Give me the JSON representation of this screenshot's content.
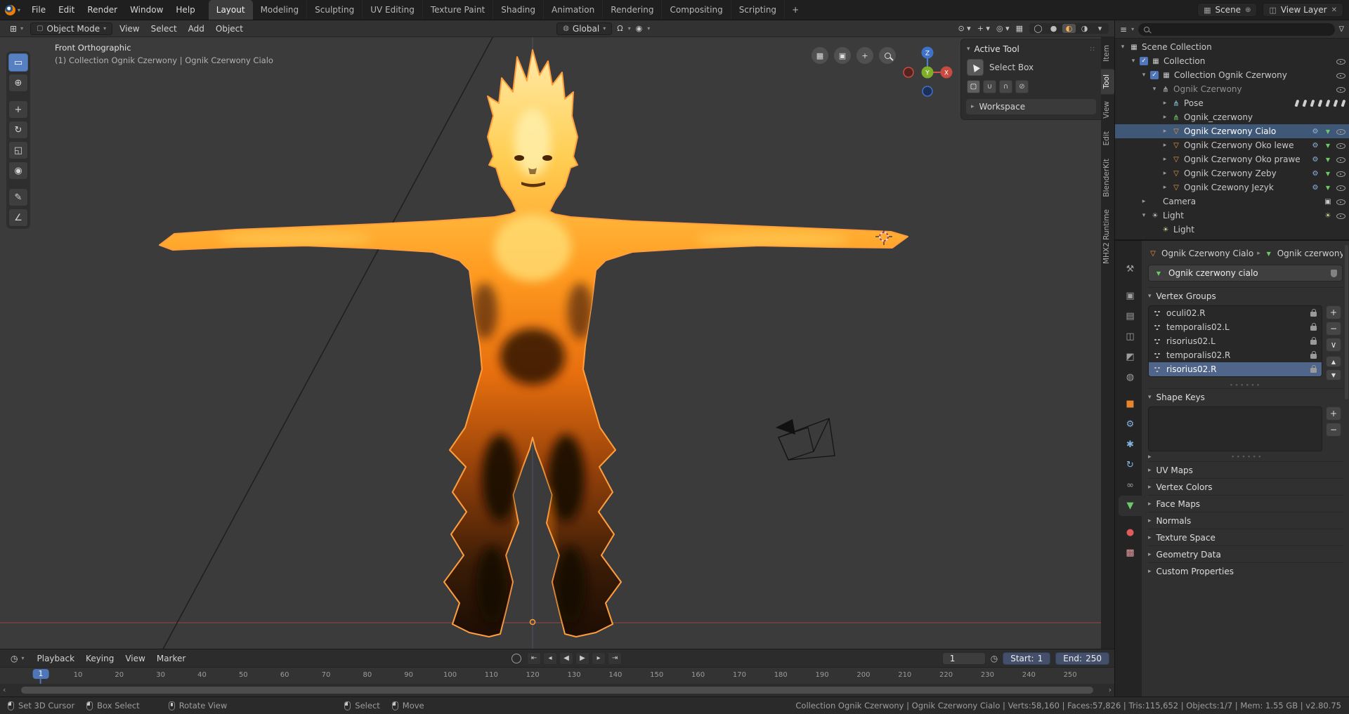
{
  "icons": {
    "editor_viewport": "⊞",
    "editor_outliner": "≡",
    "editor_timeline": "◷",
    "mode_cube": "▢",
    "orientation": "◍",
    "magnet": "Ω",
    "proportional": "◉",
    "scene": "▦",
    "view_layer": "◫",
    "new": "⊕",
    "unlink": "✕",
    "funnel": "∇",
    "breadcrumb_sep": "▸",
    "panel_dots": "∷",
    "clock": "◷",
    "scroll_left": "‹",
    "scroll_right": "›",
    "plus": "+",
    "minus": "−",
    "menu_down": "∨",
    "up": "▲",
    "down": "▼",
    "arrow_open": "▾",
    "arrow_closed": "▸"
  },
  "topbar": {
    "menus": [
      {
        "label": "File"
      },
      {
        "label": "Edit"
      },
      {
        "label": "Render"
      },
      {
        "label": "Window"
      },
      {
        "label": "Help"
      }
    ],
    "workspaces": [
      {
        "label": "Layout",
        "cls": "active"
      },
      {
        "label": "Modeling"
      },
      {
        "label": "Sculpting"
      },
      {
        "label": "UV Editing"
      },
      {
        "label": "Texture Paint"
      },
      {
        "label": "Shading"
      },
      {
        "label": "Animation"
      },
      {
        "label": "Rendering"
      },
      {
        "label": "Compositing"
      },
      {
        "label": "Scripting"
      }
    ],
    "add_workspace": "+",
    "scene_label": "Scene",
    "view_layer_label": "View Layer"
  },
  "viewport_header": {
    "mode_label": "Object Mode",
    "menus": [
      {
        "label": "View"
      },
      {
        "label": "Select"
      },
      {
        "label": "Add"
      },
      {
        "label": "Object"
      }
    ],
    "orientation_label": "Global",
    "right_icons": [
      {
        "name": "selectability-dropdown",
        "glyph": "⊙ ▾"
      },
      {
        "name": "gizmos-dropdown",
        "glyph": "+ ▾"
      },
      {
        "name": "overlays-dropdown",
        "glyph": "◎ ▾"
      },
      {
        "name": "xray-toggle",
        "glyph": "▦"
      }
    ],
    "shading_modes": [
      {
        "name": "shading-wireframe",
        "glyph": "◯"
      },
      {
        "name": "shading-solid",
        "glyph": "●"
      },
      {
        "name": "shading-material",
        "glyph": "◐",
        "cls": "active"
      },
      {
        "name": "shading-rendered",
        "glyph": "◑"
      },
      {
        "name": "shading-dropdown",
        "glyph": "▾"
      }
    ]
  },
  "toolbar": [
    {
      "name": "select-box-tool",
      "glyph": "▭",
      "cls": "active"
    },
    {
      "name": "cursor-tool",
      "glyph": "⊕"
    },
    {
      "name": "move-tool",
      "glyph": "+",
      "cls": "gap"
    },
    {
      "name": "rotate-tool",
      "glyph": "↻"
    },
    {
      "name": "scale-tool",
      "glyph": "◱"
    },
    {
      "name": "transform-tool",
      "glyph": "◉"
    },
    {
      "name": "annotate-tool",
      "glyph": "✎",
      "cls": "gap"
    },
    {
      "name": "measure-tool",
      "glyph": "∠"
    }
  ],
  "viewport": {
    "view_label": "Front Orthographic",
    "context_label": "(1) Collection Ognik Czerwony | Ognik Czerwony Cialo",
    "nav_buttons": [
      {
        "name": "orbit-grid-icon",
        "glyph": "▦"
      },
      {
        "name": "camera-view-icon",
        "glyph": "▣"
      },
      {
        "name": "pan-view-icon",
        "glyph": "+"
      },
      {
        "name": "zoom-view-icon",
        "glyph": "",
        "cls": "mag"
      }
    ],
    "gizmo": {
      "x": "X",
      "y": "Y",
      "z": "Z"
    },
    "side_tabs": [
      {
        "label": "Item"
      },
      {
        "label": "Tool",
        "cls": "active"
      },
      {
        "label": "View"
      },
      {
        "label": "Edit"
      },
      {
        "label": "BlenderKit"
      },
      {
        "label": "MHX2 Runtime"
      }
    ],
    "tool_panel": {
      "title": "Active Tool",
      "tool_name": "Select Box",
      "workspace": "Workspace",
      "options": [
        {
          "name": "select-mode-new",
          "glyph": "▢",
          "cls": "active"
        },
        {
          "name": "select-mode-extend",
          "glyph": "∪"
        },
        {
          "name": "select-mode-subtract",
          "glyph": "∩"
        },
        {
          "name": "select-mode-invert",
          "glyph": "⊘"
        }
      ]
    }
  },
  "outliner": {
    "rows": [
      {
        "label": "Scene Collection",
        "cls": "l0",
        "arrow": "▾",
        "icon": "i-scenecol",
        "right": []
      },
      {
        "label": "Collection",
        "cls": "l1",
        "arrow": "▾",
        "icon": "i-collection",
        "check": true,
        "right": [
          "i-eye"
        ]
      },
      {
        "label": "Collection Ognik Czerwony",
        "cls": "l2",
        "arrow": "▾",
        "icon": "i-collection",
        "check": true,
        "right": [
          "i-eye"
        ]
      },
      {
        "label": "Ognik Czerwony",
        "cls": "l3 dim",
        "arrow": "▾",
        "icon": "i-armature",
        "right": [
          "i-eye"
        ]
      },
      {
        "label": "Pose",
        "cls": "l4",
        "arrow": "▸",
        "icon": "i-pose",
        "right": [
          "i-bone",
          "i-bone",
          "i-bone",
          "i-bone",
          "i-bone",
          "i-bone",
          "i-bone"
        ]
      },
      {
        "label": "Ognik_czerwony",
        "cls": "l4",
        "arrow": "▸",
        "icon": "i-armdata",
        "right": []
      },
      {
        "label": "Ognik Czerwony Cialo",
        "cls": "l4 selrow",
        "arrow": "▸",
        "icon": "i-meshobj",
        "right": [
          "i-wrench",
          "i-meshdata",
          "i-eye"
        ]
      },
      {
        "label": "Ognik Czerwony Oko lewe",
        "cls": "l4",
        "arrow": "▸",
        "icon": "i-meshobj",
        "right": [
          "i-wrench",
          "i-meshdata",
          "i-eye"
        ]
      },
      {
        "label": "Ognik Czerwony Oko prawe",
        "cls": "l4",
        "arrow": "▸",
        "icon": "i-meshobj",
        "right": [
          "i-wrench",
          "i-meshdata",
          "i-eye"
        ]
      },
      {
        "label": "Ognik Czerwony Zeby",
        "cls": "l4",
        "arrow": "▸",
        "icon": "i-meshobj",
        "right": [
          "i-wrench",
          "i-meshdata",
          "i-eye"
        ]
      },
      {
        "label": "Ognik Czewony Jezyk",
        "cls": "l4",
        "arrow": "▸",
        "icon": "i-meshobj",
        "right": [
          "i-wrench",
          "i-meshdata",
          "i-eye"
        ]
      },
      {
        "label": "Camera",
        "cls": "l2",
        "arrow": "▸",
        "icon": "i-camera",
        "right": [
          "i-camdata",
          "i-eye"
        ]
      },
      {
        "label": "Light",
        "cls": "l2",
        "arrow": "▾",
        "icon": "i-light",
        "right": [
          "i-lightdata",
          "i-eye"
        ]
      },
      {
        "label": "Light",
        "cls": "l3",
        "arrow": "",
        "icon": "i-lightdata",
        "right": []
      }
    ]
  },
  "properties": {
    "tabs": [
      {
        "name": "tool-tab",
        "glyph": "⚒",
        "cls": ""
      },
      {
        "name": "render-tab",
        "glyph": "▣",
        "cls": "g-top"
      },
      {
        "name": "output-tab",
        "glyph": "▤",
        "cls": ""
      },
      {
        "name": "view-layer-tab",
        "glyph": "◫",
        "cls": ""
      },
      {
        "name": "scene-tab",
        "glyph": "◩",
        "cls": ""
      },
      {
        "name": "world-tab",
        "glyph": "◍",
        "cls": ""
      },
      {
        "name": "object-tab",
        "glyph": "■",
        "cls": "c-orange g-top"
      },
      {
        "name": "modifiers-tab",
        "glyph": "⚙",
        "cls": "c-blue"
      },
      {
        "name": "particles-tab",
        "glyph": "✱",
        "cls": "c-blue"
      },
      {
        "name": "physics-tab",
        "glyph": "↻",
        "cls": "c-blue"
      },
      {
        "name": "constraints-tab",
        "glyph": "∞",
        "cls": ""
      },
      {
        "name": "object-data-tab",
        "glyph": "▼",
        "cls": "c-green active"
      },
      {
        "name": "material-tab",
        "glyph": "●",
        "cls": "c-red g-top"
      },
      {
        "name": "texture-tab",
        "glyph": "▩",
        "cls": "c-pink"
      }
    ],
    "breadcrumb_object": "Ognik Czerwony Cialo",
    "breadcrumb_data": "Ognik czerwony c",
    "name_value": "Ognik czerwony cialo",
    "vg_title": "Vertex Groups",
    "vertex_groups": [
      {
        "label": "oculi02.R"
      },
      {
        "label": "temporalis02.L"
      },
      {
        "label": "risorius02.L"
      },
      {
        "label": "temporalis02.R"
      },
      {
        "label": "risorius02.R",
        "cls": "sel"
      }
    ],
    "sk_title": "Shape Keys",
    "sections": [
      {
        "label": "UV Maps"
      },
      {
        "label": "Vertex Colors"
      },
      {
        "label": "Face Maps"
      },
      {
        "label": "Normals"
      },
      {
        "label": "Texture Space"
      },
      {
        "label": "Geometry Data"
      },
      {
        "label": "Custom Properties"
      }
    ]
  },
  "timeline": {
    "menus": [
      {
        "label": "Playback"
      },
      {
        "label": "Keying"
      },
      {
        "label": "View"
      },
      {
        "label": "Marker"
      }
    ],
    "transport": [
      {
        "name": "jump-to-start",
        "glyph": "⇤"
      },
      {
        "name": "prev-keyframe",
        "glyph": "◂"
      },
      {
        "name": "play-reverse",
        "glyph": "◀"
      },
      {
        "name": "play",
        "glyph": "▶"
      },
      {
        "name": "next-keyframe",
        "glyph": "▸"
      },
      {
        "name": "jump-to-end",
        "glyph": "⇥"
      }
    ],
    "ticks": [
      10,
      20,
      30,
      40,
      50,
      60,
      70,
      80,
      90,
      100,
      110,
      120,
      130,
      140,
      150,
      160,
      170,
      180,
      190,
      200,
      210,
      220,
      230,
      240,
      250
    ],
    "current_frame": "1",
    "start_label": "Start:",
    "start_value": "1",
    "end_label": "End:",
    "end_value": "250"
  },
  "statusbar": {
    "hints": [
      {
        "label": "Set 3D Cursor",
        "btn": "m-left"
      },
      {
        "label": "Box Select",
        "btn": "m-left"
      },
      {
        "label": "Rotate View",
        "btn": "m-mid",
        "cls": "sp1"
      },
      {
        "label": "Select",
        "btn": "m-left",
        "cls": "sp2"
      },
      {
        "label": "Move",
        "btn": "m-left"
      }
    ],
    "stats": "Collection Ognik Czerwony | Ognik Czerwony Cialo | Verts:58,160 | Faces:57,826 | Tris:115,652 | Objects:1/7 | Mem: 1.55 GB | v2.80.75"
  }
}
